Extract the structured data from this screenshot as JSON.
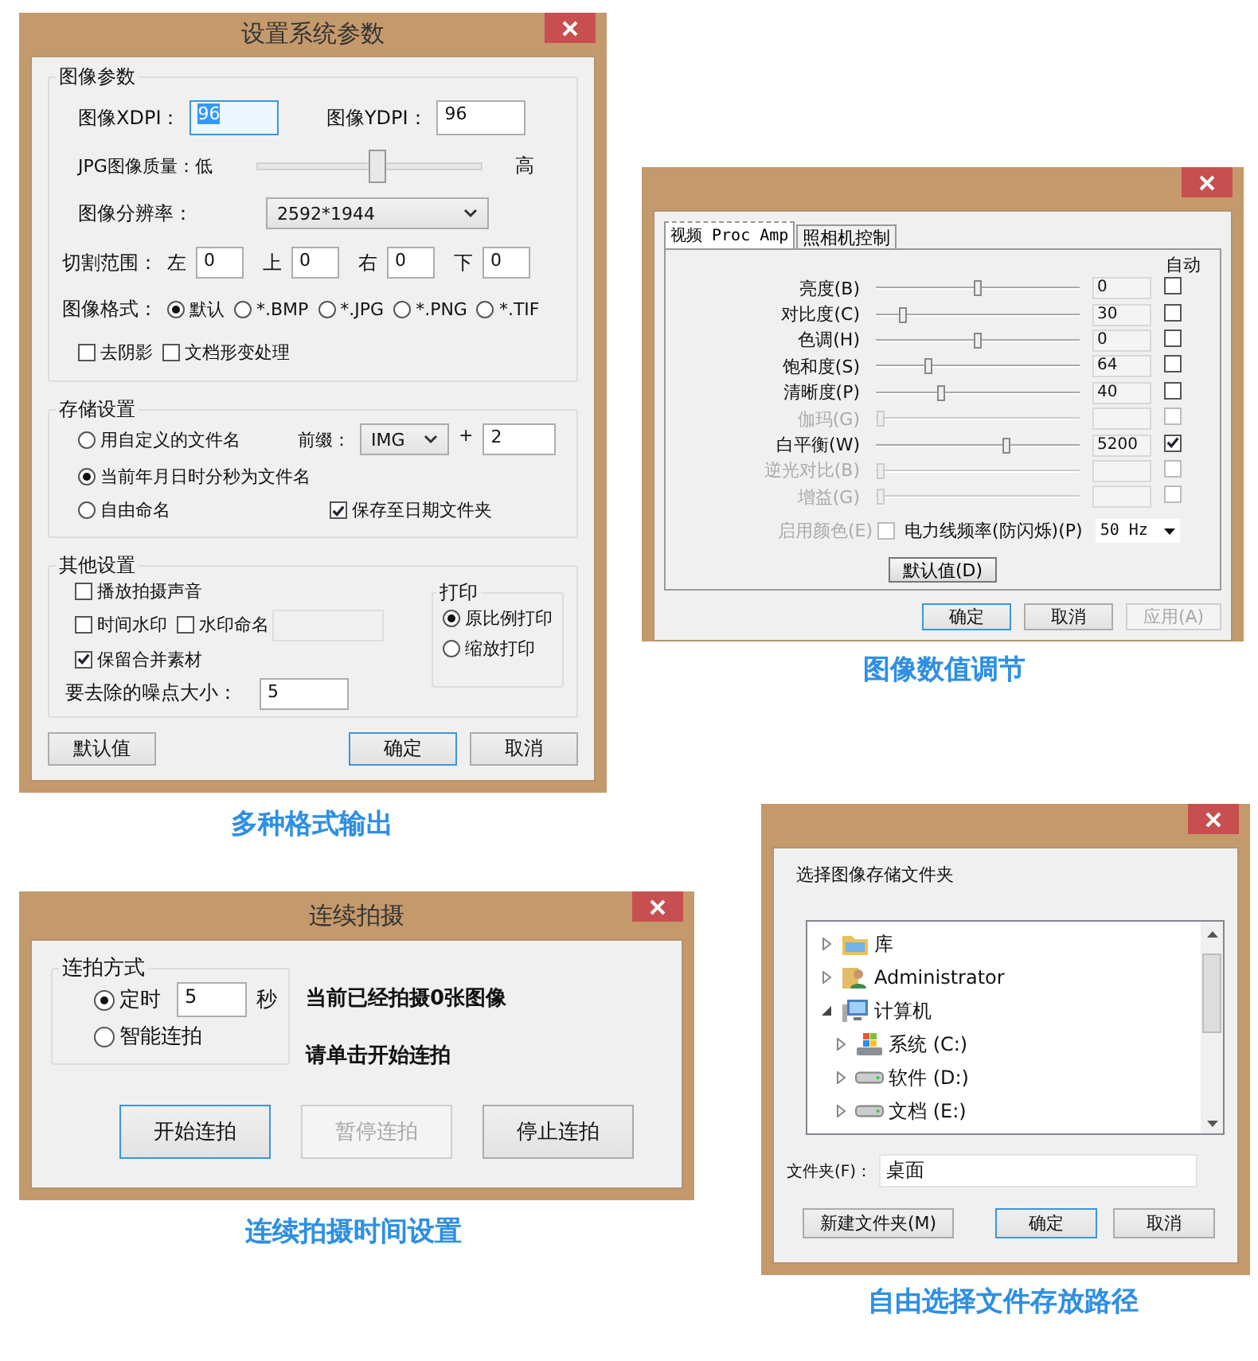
{
  "settings_dialog": {
    "title": "设置系统参数",
    "image_group": {
      "legend": "图像参数",
      "dpi_fields": [
        {
          "label": "图像XDPI：",
          "value": "96",
          "highlighted": true
        },
        {
          "label": "图像YDPI：",
          "value": "96",
          "highlighted": false
        }
      ],
      "quality": {
        "label": "JPG图像质量：低",
        "high_label": "高",
        "level": 0.53
      },
      "resolution": {
        "label": "图像分辨率：",
        "value": "2592*1944"
      },
      "crop": {
        "label": "切割范围：",
        "fields": [
          {
            "label": "左",
            "value": "0"
          },
          {
            "label": "上",
            "value": "0"
          },
          {
            "label": "右",
            "value": "0"
          },
          {
            "label": "下",
            "value": "0"
          }
        ]
      },
      "format": {
        "label": "图像格式：",
        "options": [
          {
            "label": "默认",
            "selected": true
          },
          {
            "label": "*.BMP",
            "selected": false
          },
          {
            "label": "*.JPG",
            "selected": false
          },
          {
            "label": "*.PNG",
            "selected": false
          },
          {
            "label": "*.TIF",
            "selected": false
          }
        ]
      },
      "checkboxes": [
        {
          "label": "去阴影",
          "checked": false
        },
        {
          "label": "文档形变处理",
          "checked": false
        }
      ]
    },
    "storage_group": {
      "legend": "存储设置",
      "options": [
        {
          "label": "用自定义的文件名",
          "selected": false
        },
        {
          "label": "当前年月日时分秒为文件名",
          "selected": true
        },
        {
          "label": "自由命名",
          "selected": false
        }
      ],
      "prefix": {
        "label": "前缀：",
        "value": "IMG",
        "plus": "+",
        "number": "2"
      },
      "date_folder": {
        "label": "保存至日期文件夹",
        "checked": true
      }
    },
    "other_group": {
      "legend": "其他设置",
      "checkboxes": [
        {
          "label": "播放拍摄声音",
          "checked": false
        },
        {
          "label": "时间水印",
          "checked": false
        },
        {
          "label": "水印命名",
          "checked": false
        },
        {
          "label": "保留合并素材",
          "checked": true
        }
      ],
      "noise": {
        "label": "要去除的噪点大小：",
        "value": "5"
      },
      "print": {
        "legend": "打印",
        "options": [
          {
            "label": "原比例打印",
            "selected": true
          },
          {
            "label": "缩放打印",
            "selected": false
          }
        ]
      }
    },
    "buttons": [
      {
        "label": "默认值",
        "default": false
      },
      {
        "label": "确定",
        "default": true
      },
      {
        "label": "取消",
        "default": false
      }
    ],
    "caption": "多种格式输出"
  },
  "proc_amp_dialog": {
    "tabs": [
      {
        "label": "视频 Proc Amp",
        "selected": true
      },
      {
        "label": "照相机控制",
        "selected": false
      }
    ],
    "auto_header": "自动",
    "rows": [
      {
        "label": "亮度(B)",
        "value": "0",
        "level": 0.5,
        "auto": false,
        "disabled": false
      },
      {
        "label": "对比度(C)",
        "value": "30",
        "level": 0.13,
        "auto": false,
        "disabled": false
      },
      {
        "label": "色调(H)",
        "value": "0",
        "level": 0.5,
        "auto": false,
        "disabled": false
      },
      {
        "label": "饱和度(S)",
        "value": "64",
        "level": 0.26,
        "auto": false,
        "disabled": false
      },
      {
        "label": "清晰度(P)",
        "value": "40",
        "level": 0.32,
        "auto": false,
        "disabled": false
      },
      {
        "label": "伽玛(G)",
        "level": 0.02,
        "auto": false,
        "disabled": true
      },
      {
        "label": "白平衡(W)",
        "value": "5200",
        "level": 0.64,
        "auto": true,
        "disabled": false
      },
      {
        "label": "逆光对比(B)",
        "level": 0.02,
        "auto": false,
        "disabled": true
      },
      {
        "label": "增益(G)",
        "level": 0.02,
        "auto": false,
        "disabled": true
      }
    ],
    "color_enable": {
      "label": "启用颜色(E)",
      "checked": false,
      "disabled": true
    },
    "powerline": {
      "label": "电力线频率(防闪烁)(P)",
      "value": "50 Hz"
    },
    "default_button": "默认值(D)",
    "buttons": [
      {
        "label": "确定",
        "default": true,
        "disabled": false
      },
      {
        "label": "取消",
        "default": false,
        "disabled": false
      },
      {
        "label": "应用(A)",
        "default": false,
        "disabled": true
      }
    ],
    "caption": "图像数值调节"
  },
  "burst_dialog": {
    "title": "连续拍摄",
    "mode_group": {
      "legend": "连拍方式",
      "options": [
        {
          "label": "定时",
          "selected": true
        },
        {
          "label": "智能连拍",
          "selected": false
        }
      ],
      "interval": {
        "value": "5",
        "unit": "秒"
      }
    },
    "status_lines": [
      "当前已经拍摄0张图像",
      "请单击开始连拍"
    ],
    "buttons": [
      {
        "label": "开始连拍",
        "default": true,
        "disabled": false
      },
      {
        "label": "暂停连拍",
        "default": false,
        "disabled": true
      },
      {
        "label": "停止连拍",
        "default": false,
        "disabled": false
      }
    ],
    "caption": "连续拍摄时间设置"
  },
  "folder_dialog": {
    "prompt": "选择图像存储文件夹",
    "tree": [
      {
        "kind": "library",
        "label": "库",
        "expanded": false
      },
      {
        "kind": "user",
        "label": "Administrator",
        "expanded": false
      },
      {
        "kind": "computer",
        "label": "计算机",
        "expanded": true,
        "children": [
          {
            "kind": "system-drive",
            "label": "系统 (C:)",
            "expanded": false
          },
          {
            "kind": "drive",
            "label": "软件 (D:)",
            "expanded": false
          },
          {
            "kind": "drive",
            "label": "文档 (E:)",
            "expanded": false
          }
        ]
      }
    ],
    "folder_field": {
      "label": "文件夹(F)：",
      "value": "桌面"
    },
    "buttons": [
      {
        "label": "新建文件夹(M)",
        "default": false
      },
      {
        "label": "确定",
        "default": true
      },
      {
        "label": "取消",
        "default": false
      }
    ],
    "caption": "自由选择文件存放路径"
  }
}
